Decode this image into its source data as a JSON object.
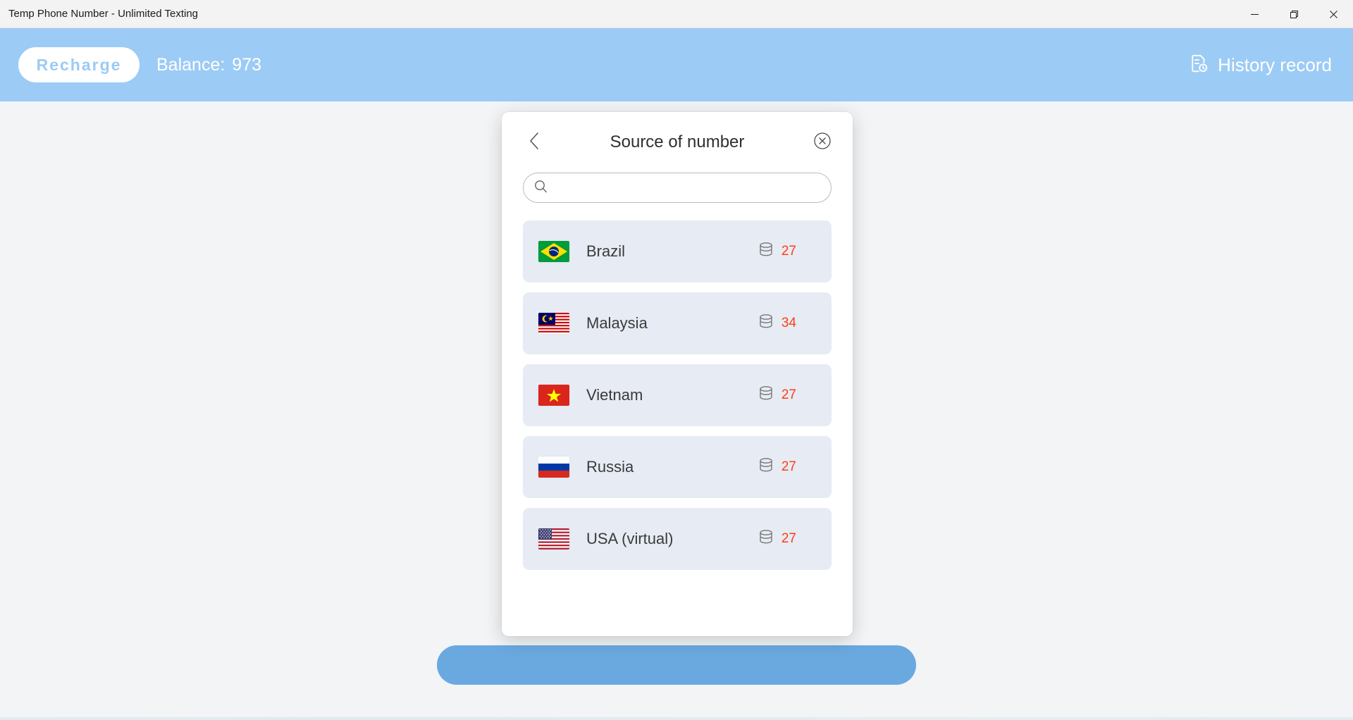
{
  "window": {
    "title": "Temp Phone Number - Unlimited Texting",
    "controls": {
      "minimize": "minimize-button",
      "maximize": "maximize-button",
      "close": "close-button"
    }
  },
  "app_header": {
    "recharge_label": "Recharge",
    "balance_label": "Balance:",
    "balance_value": "973",
    "history_label": "History record",
    "history_icon": "document-clock-icon",
    "background_color": "#9ccbf5"
  },
  "modal": {
    "title": "Source of number",
    "back_icon": "chevron-left-icon",
    "close_icon": "close-circle-icon",
    "search": {
      "icon": "search-icon",
      "value": "",
      "placeholder": ""
    },
    "countries": [
      {
        "name": "Brazil",
        "flag": "br",
        "count": "27",
        "count_icon": "database-icon"
      },
      {
        "name": "Malaysia",
        "flag": "my",
        "count": "34",
        "count_icon": "database-icon"
      },
      {
        "name": "Vietnam",
        "flag": "vn",
        "count": "27",
        "count_icon": "database-icon"
      },
      {
        "name": "Russia",
        "flag": "ru",
        "count": "27",
        "count_icon": "database-icon"
      },
      {
        "name": "USA (virtual)",
        "flag": "us",
        "count": "27",
        "count_icon": "database-icon"
      }
    ]
  },
  "colors": {
    "header_blue": "#9ccbf5",
    "page_bg": "#f2f4f6",
    "row_bg": "#e6ebf4",
    "count_red": "#ff3d15",
    "accent_button": "#6aa9e0"
  }
}
